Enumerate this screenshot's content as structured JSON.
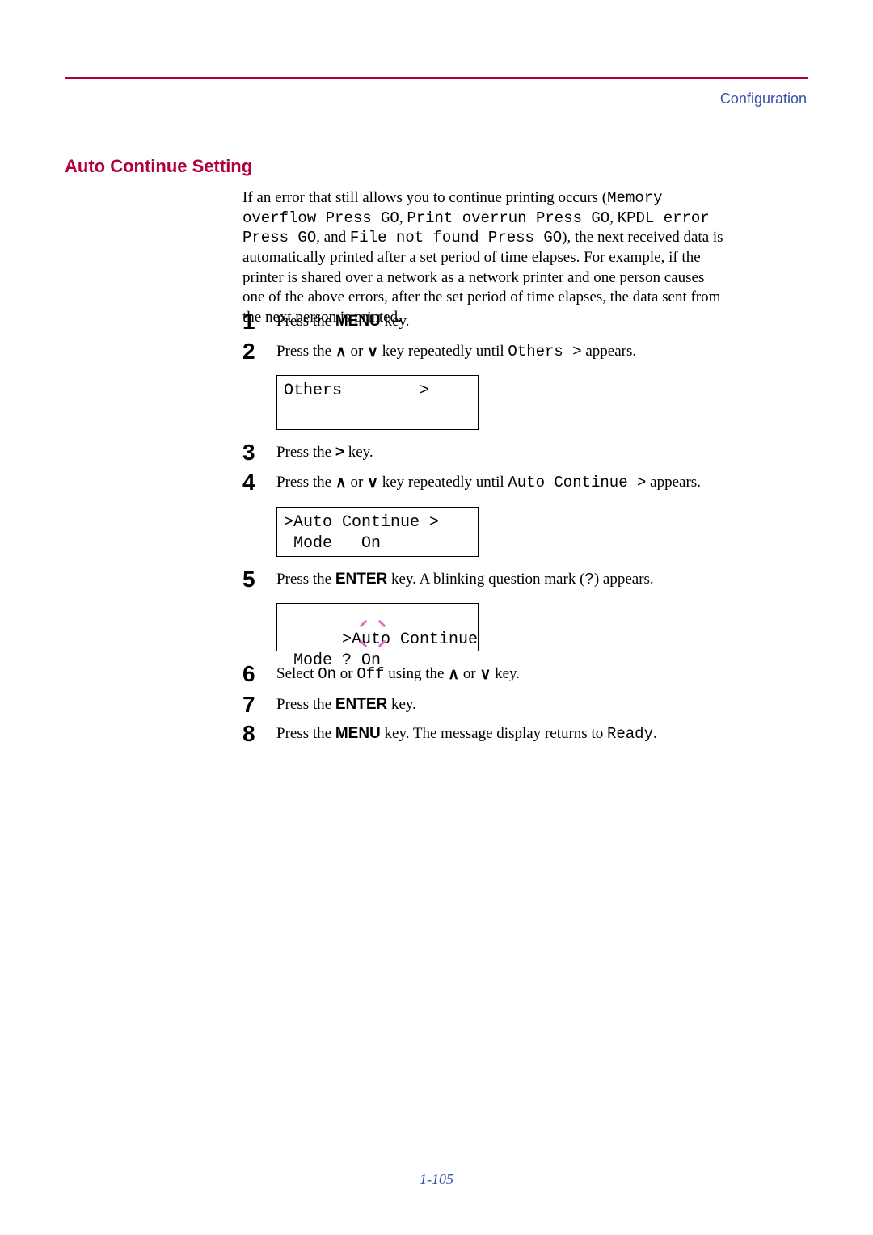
{
  "header": {
    "section": "Configuration"
  },
  "title": "Auto Continue Setting",
  "intro": {
    "p1a": "If an error that still allows you to continue printing occurs (",
    "m1": "Memory overflow Press GO",
    "c1": ", ",
    "m2": "Print overrun Press GO",
    "c2": ", ",
    "m3": "KPDL error Press GO",
    "c3": ", and ",
    "m4": "File not found Press GO",
    "p1b": "), the next received data is automatically printed after a set period of time elapses. For example, if the printer is shared over a network as a network printer and one person causes one of the above errors, after the set period of time elapses, the data sent from the next person is printed."
  },
  "steps": {
    "s1": {
      "n": "1",
      "a": "Press the ",
      "b": "MENU",
      "c": " key."
    },
    "s2": {
      "n": "2",
      "a": "Press the ",
      "mid": " or ",
      "b": " key repeatedly until ",
      "mono": "Others  >",
      "c": " appears."
    },
    "lcd1": "Others        >",
    "s3": {
      "n": "3",
      "a": "Press the ",
      "b": ">",
      "c": " key."
    },
    "s4": {
      "n": "4",
      "a": "Press the ",
      "mid": " or ",
      "b": " key repeatedly until ",
      "mono": "Auto Continue >",
      "c": " appears."
    },
    "lcd2": ">Auto Continue >\n Mode   On",
    "s5": {
      "n": "5",
      "a": "Press the ",
      "b": "ENTER",
      "c": " key. A blinking question mark (",
      "mono": "?",
      "d": ") appears."
    },
    "lcd3": ">Auto Continue\n Mode ? On",
    "s6": {
      "n": "6",
      "a": "Select ",
      "m1": "On",
      "mid": " or ",
      "m2": "Off",
      "b": " using the ",
      "mid2": " or ",
      "c": " key."
    },
    "s7": {
      "n": "7",
      "a": "Press the ",
      "b": "ENTER",
      "c": " key."
    },
    "s8": {
      "n": "8",
      "a": "Press the ",
      "b": "MENU",
      "c": " key. The message display returns to ",
      "mono": "Ready",
      "d": "."
    }
  },
  "footer": {
    "page": "1-105"
  },
  "arrows": {
    "up": "∧",
    "down": "∨"
  }
}
